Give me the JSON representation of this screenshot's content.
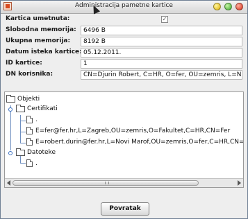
{
  "window": {
    "title": "Administracija pametne kartice",
    "controls": [
      "minimize-icon",
      "maximize-icon",
      "close-icon"
    ]
  },
  "info": {
    "inserted_label": "Kartica umetnuta:",
    "inserted_checked": true,
    "checkmark": "✓",
    "free_label": "Slobodna memorija:",
    "free_value": "6496 B",
    "total_label": "Ukupna memorija:",
    "total_value": "8192 B",
    "expiry_label": "Datum isteka kartice:",
    "expiry_value": "05.12.2011.",
    "id_label": "ID kartice:",
    "id_value": "1",
    "dn_label": "DN korisnika:",
    "dn_value": "CN=Djurin Robert, C=HR, O=fer, OU=zemris, L=Novi"
  },
  "tree": {
    "root": "Objekti",
    "cert_folder": "Certifikati",
    "cert_item_1": ".",
    "cert_item_2": "E=fer@fer.hr,L=Zagreb,OU=zemris,O=Fakultet,C=HR,CN=Fer",
    "cert_item_3": "E=robert.durin@fer.hr,L=Novi Marof,OU=zemris,O=fer,C=HR,CN=Djur",
    "data_folder": "Datoteke",
    "data_item_1": "."
  },
  "actions": {
    "back_label": "Povratak"
  }
}
